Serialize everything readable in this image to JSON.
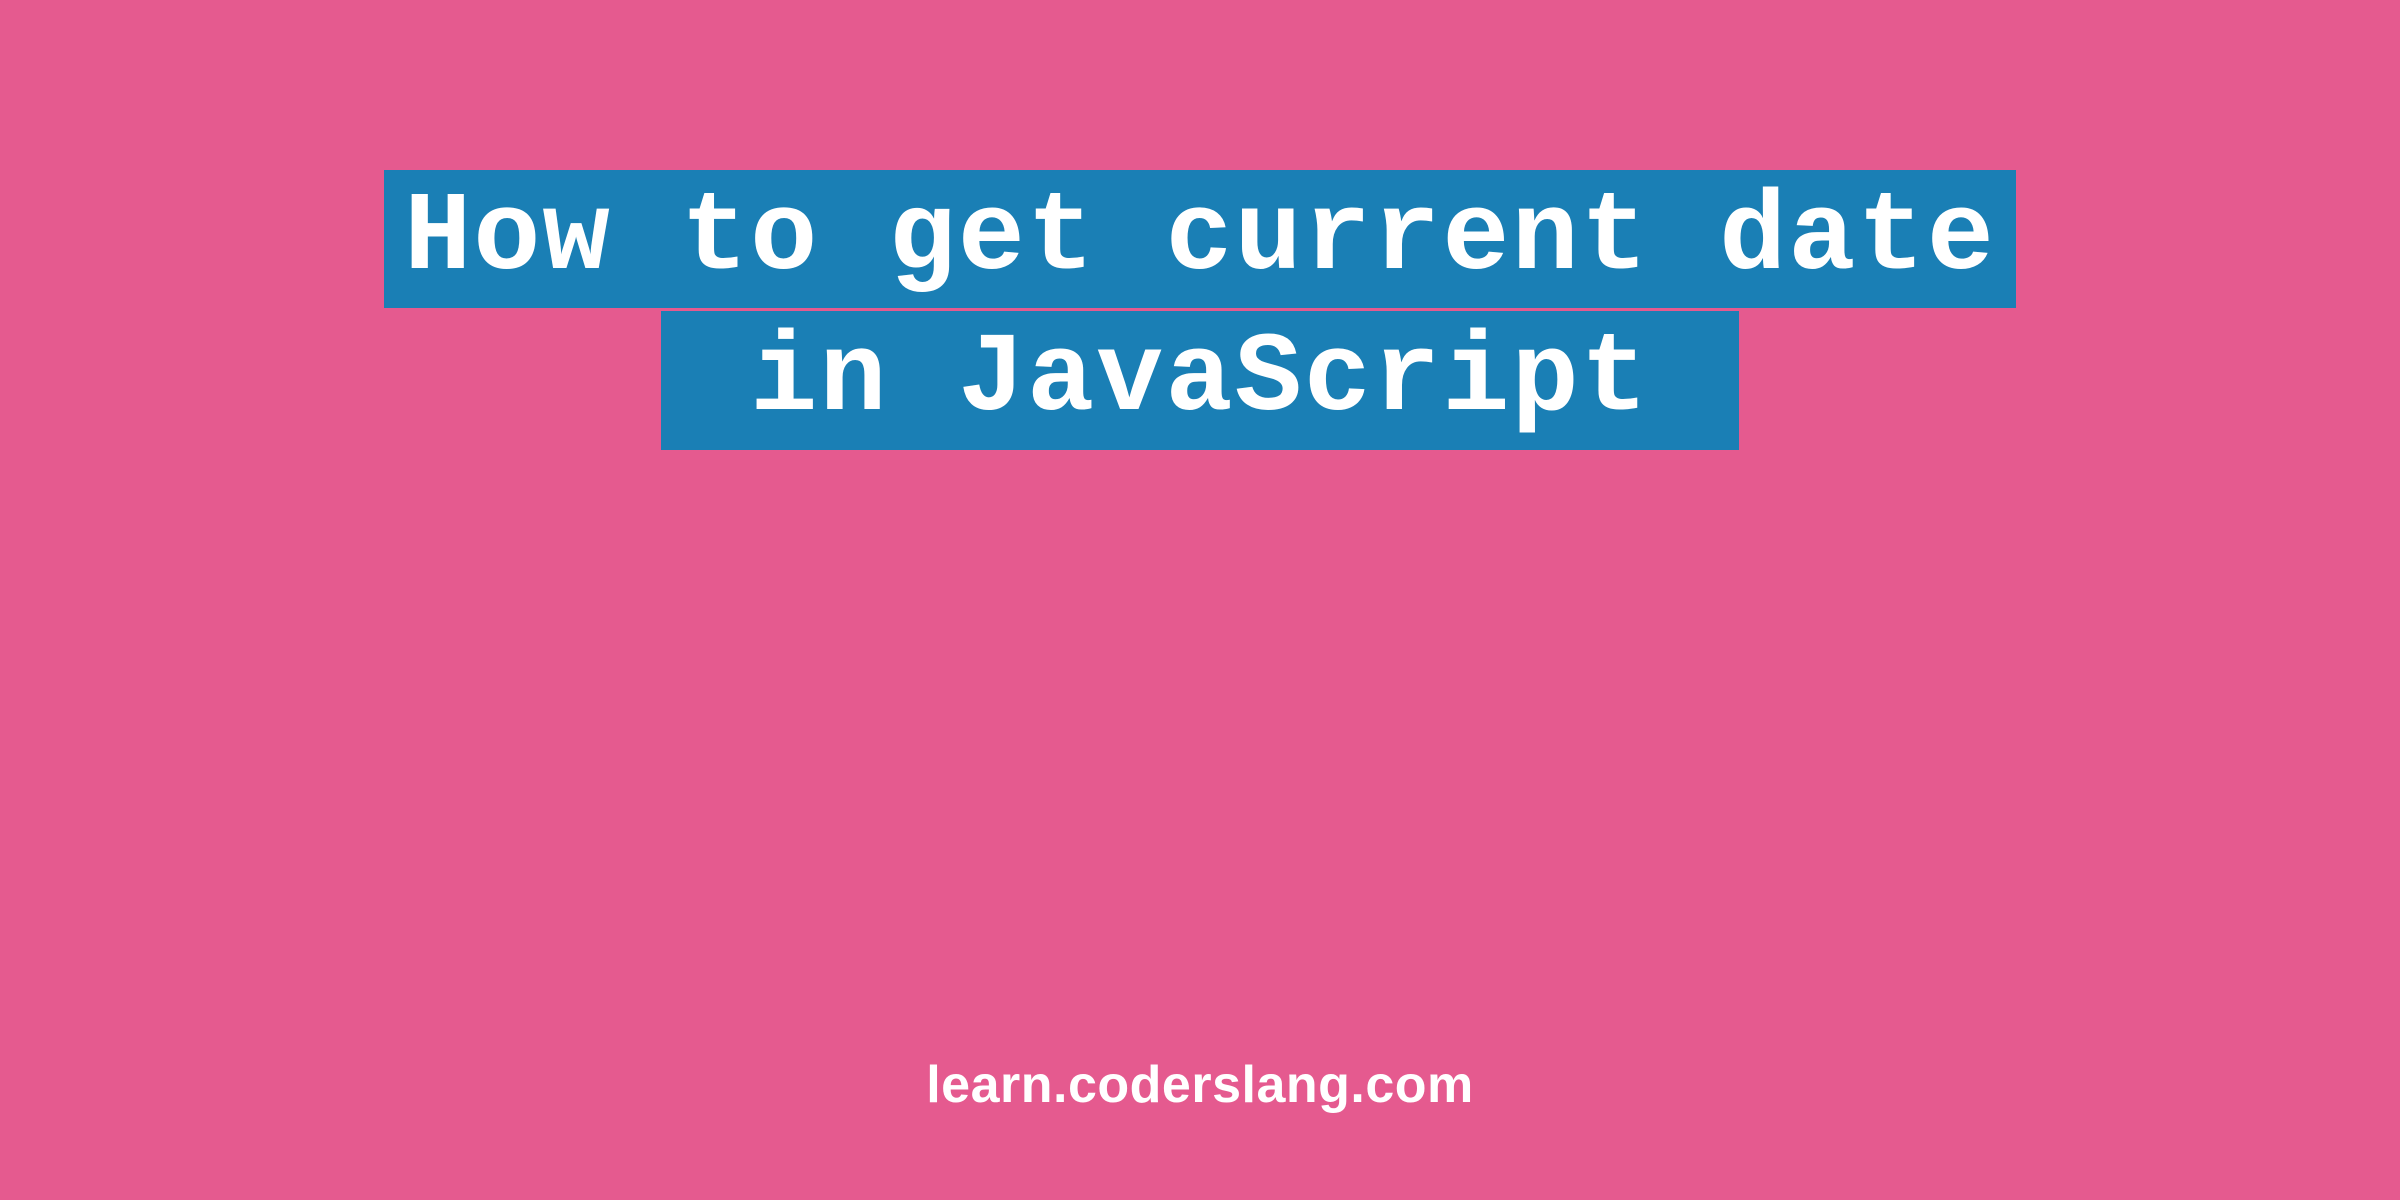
{
  "title": {
    "line1": "How to get current date",
    "line2": " in JavaScript "
  },
  "footer": {
    "domain": "learn.coderslang.com"
  },
  "colors": {
    "background": "#e55a8f",
    "highlight": "#1a7fb5",
    "text": "#ffffff"
  }
}
